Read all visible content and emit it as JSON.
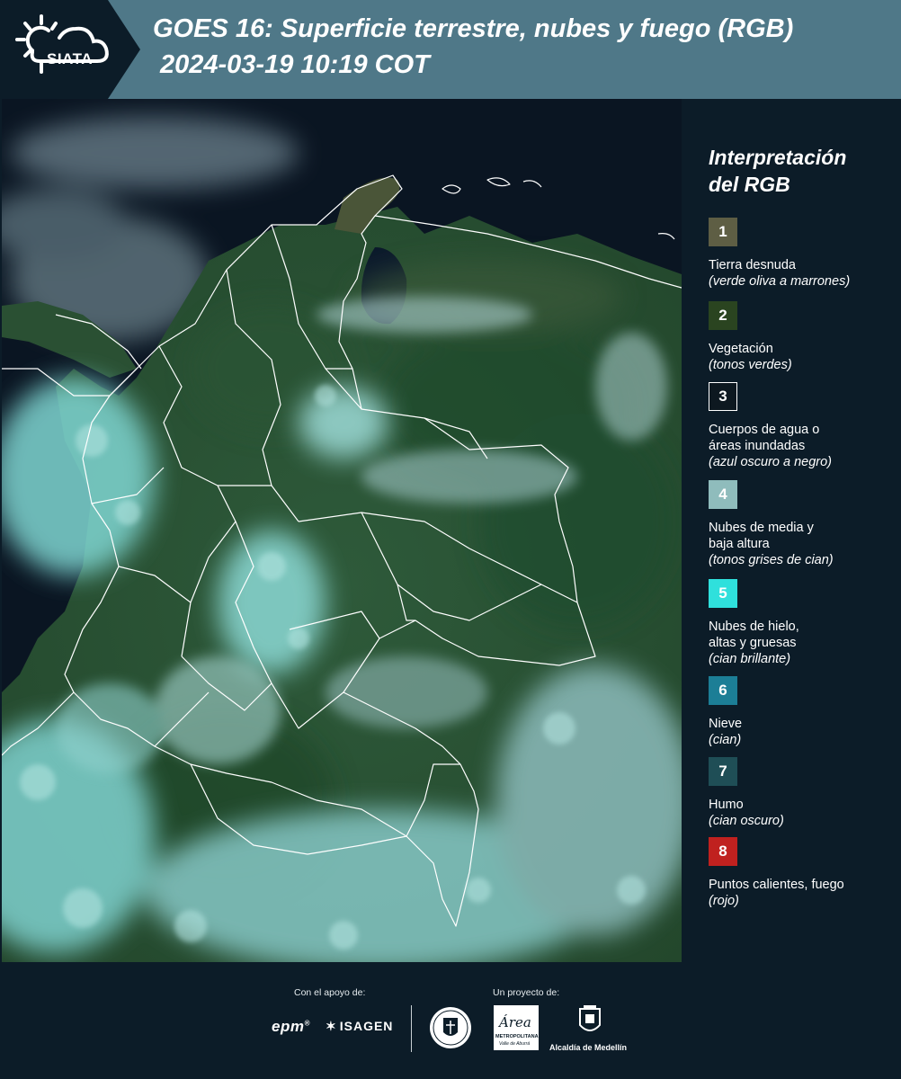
{
  "header": {
    "logo_text": "SIATA",
    "title_line1": "GOES 16: Superficie terrestre, nubes y fuego (RGB)",
    "title_line2": "2024-03-19 10:19 COT"
  },
  "legend": {
    "title_line1": "Interpretación",
    "title_line2": "del RGB",
    "items": [
      {
        "num": "1",
        "color": "#5e5e44",
        "label": "Tierra desnuda",
        "sub": "(verde oliva a marrones)"
      },
      {
        "num": "2",
        "color": "#2a4420",
        "label": "Vegetación",
        "sub": "(tonos verdes)"
      },
      {
        "num": "3",
        "color": "#0d1820",
        "label": "Cuerpos de agua o áreas inundadas",
        "sub": "(azul oscuro a negro)"
      },
      {
        "num": "4",
        "color": "#8fbcbc",
        "label": "Nubes de media y baja altura",
        "sub": "(tonos grises de cian)"
      },
      {
        "num": "5",
        "color": "#2fe0dc",
        "label": "Nubes de hielo, altas y gruesas",
        "sub": "(cian brillante)"
      },
      {
        "num": "6",
        "color": "#1c7e96",
        "label": "Nieve",
        "sub": "(cian)"
      },
      {
        "num": "7",
        "color": "#1f4e56",
        "label": "Humo",
        "sub": "(cian oscuro)"
      },
      {
        "num": "8",
        "color": "#c0211f",
        "label": "Puntos calientes, fuego",
        "sub": "(rojo)"
      }
    ]
  },
  "footer": {
    "support_label": "Con el apoyo de:",
    "project_label": "Un proyecto de:",
    "sponsor_epm": "epm",
    "sponsor_isagen": "ISAGEN",
    "area_text": "Área",
    "area_sub": "METROPOLITANA",
    "area_sub2": "Valle de Aburrá",
    "alcaldia": "Alcaldía de Medellín"
  },
  "map": {
    "ocean_color": "#0a1522",
    "land_color": "#2f5a3a",
    "cloud_color": "#7fd6d2",
    "border_color": "#ffffff"
  }
}
